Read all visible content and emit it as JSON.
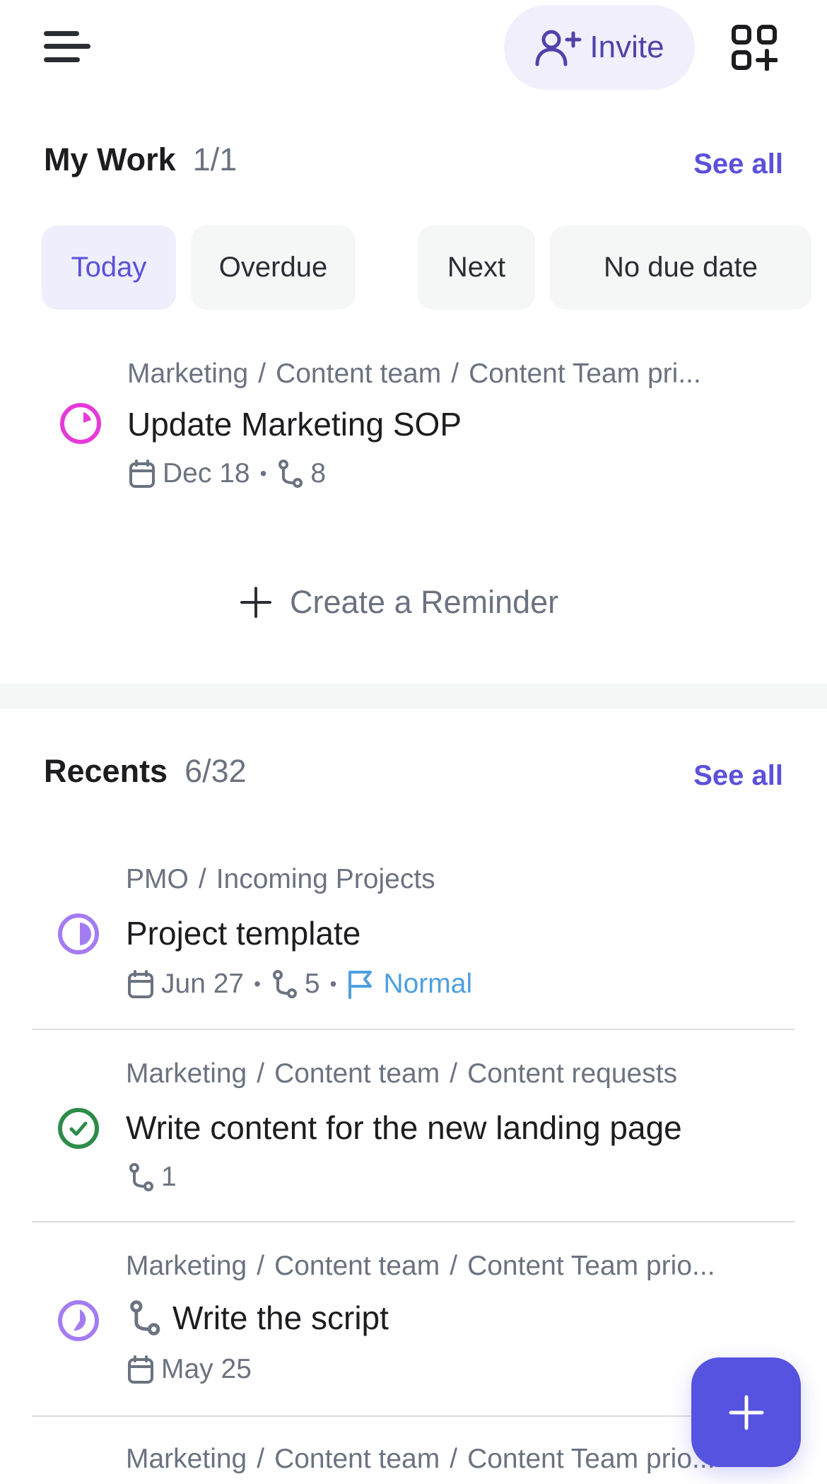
{
  "header": {
    "menu_icon": "hamburger-menu-icon",
    "invite_label": "Invite",
    "invite_icon": "user-plus-icon",
    "apps_icon": "grid-plus-icon"
  },
  "my_work": {
    "title": "My Work",
    "count": "1/1",
    "see_all": "See all",
    "tabs": [
      {
        "label": "Today",
        "active": true
      },
      {
        "label": "Overdue",
        "active": false
      },
      {
        "label": "Next",
        "active": false
      },
      {
        "label": "No due date",
        "active": false
      }
    ],
    "tasks": [
      {
        "breadcrumb": [
          "Marketing",
          "Content team",
          "Content Team pri..."
        ],
        "title": "Update Marketing SOP",
        "status_color": "#e63ad8",
        "due": "Dec 18",
        "subtasks": "8"
      }
    ],
    "create_reminder": "Create a Reminder"
  },
  "recents": {
    "title": "Recents",
    "count": "6/32",
    "see_all": "See all",
    "items": [
      {
        "breadcrumb": [
          "PMO",
          "Incoming Projects"
        ],
        "title": "Project template",
        "status_color": "#a47cf2",
        "due": "Jun 27",
        "subtasks": "5",
        "priority": "Normal",
        "priority_color": "#4d9fe0"
      },
      {
        "breadcrumb": [
          "Marketing",
          "Content team",
          "Content requests"
        ],
        "title": "Write content for the new landing page",
        "status_color": "#2e8b4a",
        "subtasks": "1"
      },
      {
        "breadcrumb": [
          "Marketing",
          "Content team",
          "Content Team prio..."
        ],
        "title": "Write the script",
        "status_color": "#a47cf2",
        "due": "May 25"
      },
      {
        "breadcrumb": [
          "Marketing",
          "Content team",
          "Content Team prio..."
        ]
      }
    ]
  },
  "fab": {
    "icon": "plus-icon",
    "color": "#5653e0"
  },
  "colors": {
    "accent": "#5b50dc",
    "muted": "#6b7280"
  }
}
